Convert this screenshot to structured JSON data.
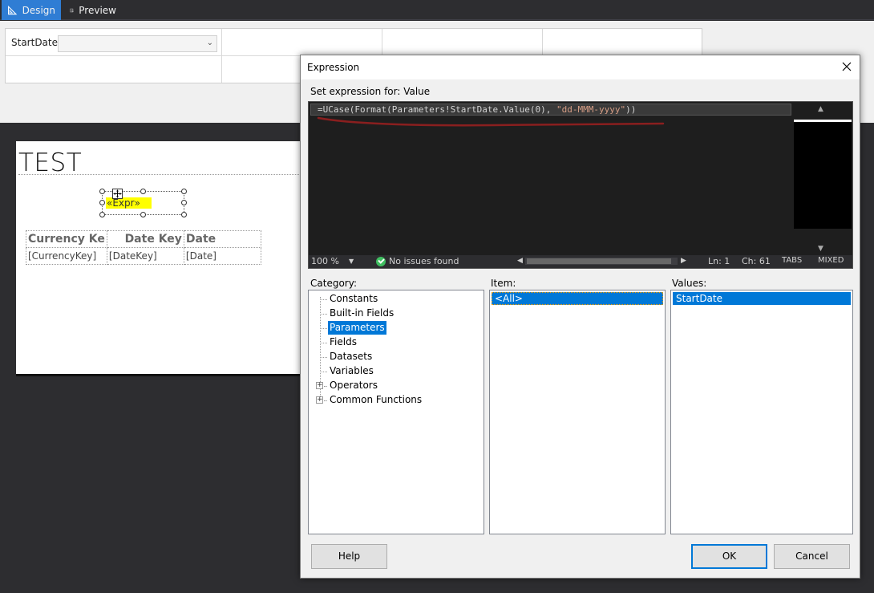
{
  "tabs": {
    "design": "Design",
    "preview": "Preview"
  },
  "parameters": {
    "start_date_label": "StartDate",
    "start_date_value": ""
  },
  "report": {
    "title": "TEST",
    "expr_placeholder": "«Expr»",
    "table": {
      "headers": [
        "Currency Ke",
        "Date Key",
        "Date"
      ],
      "row": [
        "[CurrencyKey]",
        "[DateKey]",
        "[Date]"
      ]
    }
  },
  "dialog": {
    "title": "Expression",
    "set_expression_label": "Set expression for: Value",
    "expression_prefix": "=UCase(Format(Parameters!StartDate.Value(0), ",
    "expression_string": "\"dd-MMM-yyyy\"",
    "expression_suffix": "))",
    "status": {
      "zoom": "100 %",
      "issues": "No issues found",
      "line": "Ln: 1",
      "column": "Ch: 61",
      "tabs": "TABS",
      "mixed": "MIXED"
    },
    "category_label": "Category:",
    "item_label": "Item:",
    "values_label": "Values:",
    "categories": [
      {
        "label": "Constants",
        "expandable": false,
        "selected": false
      },
      {
        "label": "Built-in Fields",
        "expandable": false,
        "selected": false
      },
      {
        "label": "Parameters",
        "expandable": false,
        "selected": true
      },
      {
        "label": "Fields",
        "expandable": false,
        "selected": false
      },
      {
        "label": "Datasets",
        "expandable": false,
        "selected": false
      },
      {
        "label": "Variables",
        "expandable": false,
        "selected": false
      },
      {
        "label": "Operators",
        "expandable": true,
        "selected": false
      },
      {
        "label": "Common Functions",
        "expandable": true,
        "selected": false
      }
    ],
    "items": [
      "<All>"
    ],
    "values": [
      "StartDate"
    ],
    "buttons": {
      "help": "Help",
      "ok": "OK",
      "cancel": "Cancel"
    }
  },
  "colors": {
    "accent": "#0078d7",
    "design_tab": "#2f7dd4",
    "highlight": "#ffff00",
    "dark_bg": "#2d2d30",
    "string_literal": "#d69d85"
  }
}
